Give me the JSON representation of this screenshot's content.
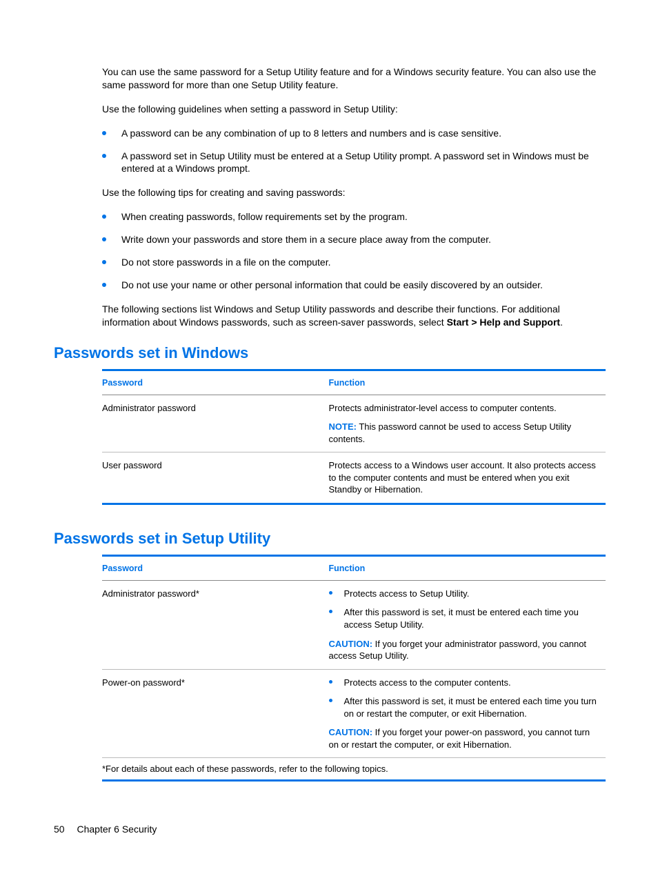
{
  "intro": {
    "p1": "You can use the same password for a Setup Utility feature and for a Windows security feature. You can also use the same password for more than one Setup Utility feature.",
    "p2": "Use the following guidelines when setting a password in Setup Utility:",
    "guidelines": [
      "A password can be any combination of up to 8 letters and numbers and is case sensitive.",
      "A password set in Setup Utility must be entered at a Setup Utility prompt. A password set in Windows must be entered at a Windows prompt."
    ],
    "p3": "Use the following tips for creating and saving passwords:",
    "tips": [
      "When creating passwords, follow requirements set by the program.",
      "Write down your passwords and store them in a secure place away from the computer.",
      "Do not store passwords in a file on the computer.",
      "Do not use your name or other personal information that could be easily discovered by an outsider."
    ],
    "p4a": "The following sections list Windows and Setup Utility passwords and describe their functions. For additional information about Windows passwords, such as screen-saver passwords, select ",
    "p4b": "Start > Help and Support",
    "p4c": "."
  },
  "windows": {
    "heading": "Passwords set in Windows",
    "col1": "Password",
    "col2": "Function",
    "rows": [
      {
        "name": "Administrator password",
        "desc": "Protects administrator-level access to computer contents.",
        "noteLabel": "NOTE:",
        "note": "This password cannot be used to access Setup Utility contents."
      },
      {
        "name": "User password",
        "desc": "Protects access to a Windows user account. It also protects access to the computer contents and must be entered when you exit Standby or Hibernation."
      }
    ]
  },
  "setup": {
    "heading": "Passwords set in Setup Utility",
    "col1": "Password",
    "col2": "Function",
    "rows": [
      {
        "name": "Administrator password*",
        "bullets": [
          "Protects access to Setup Utility.",
          "After this password is set, it must be entered each time you access Setup Utility."
        ],
        "cautionLabel": "CAUTION:",
        "caution": "If you forget your administrator password, you cannot access Setup Utility."
      },
      {
        "name": "Power-on password*",
        "bullets": [
          "Protects access to the computer contents.",
          "After this password is set, it must be entered each time you turn on or restart the computer, or exit Hibernation."
        ],
        "cautionLabel": "CAUTION:",
        "caution": "If you forget your power-on password, you cannot turn on or restart the computer, or exit Hibernation."
      }
    ],
    "footnote": "*For details about each of these passwords, refer to the following topics."
  },
  "footer": {
    "page": "50",
    "chapter": "Chapter 6   Security"
  }
}
